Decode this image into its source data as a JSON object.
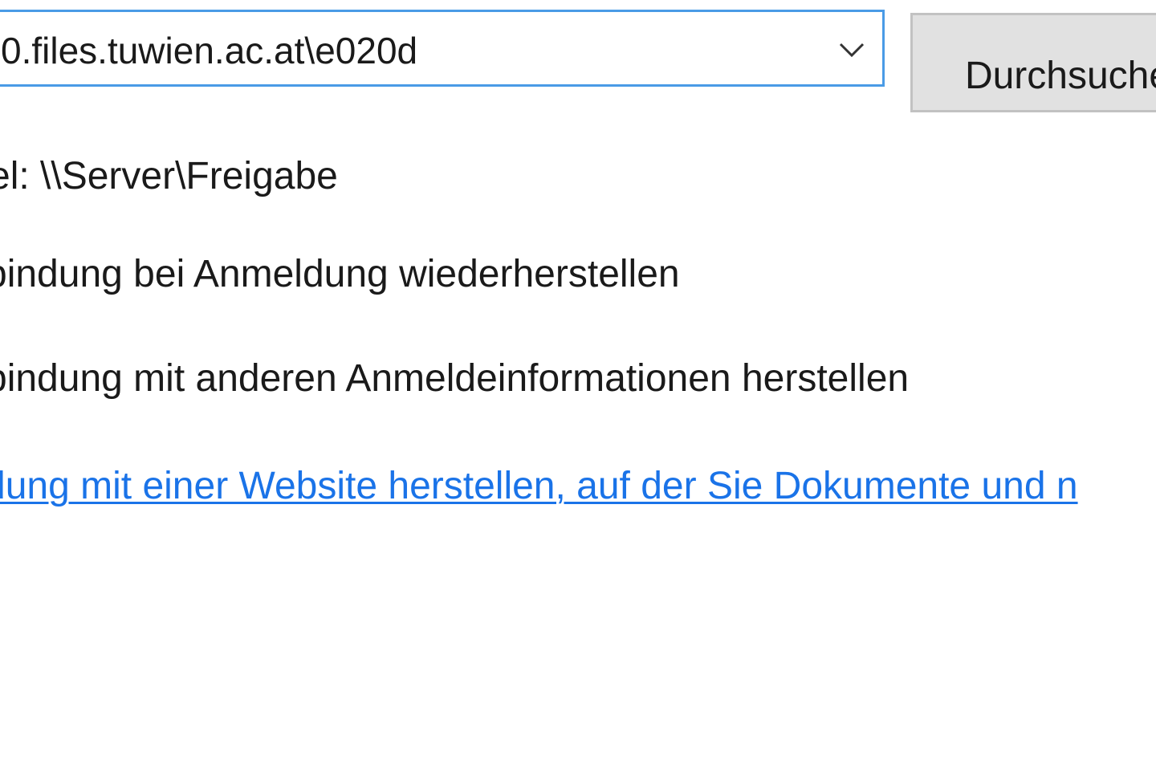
{
  "folder": {
    "value": "0.files.tuwien.ac.at\\e020d",
    "dropdown_icon": "chevron-down-icon"
  },
  "browse_button": {
    "label": "Durchsuche"
  },
  "example": {
    "text": "el: \\\\Server\\Freigabe"
  },
  "options": {
    "reconnect_label": "bindung bei Anmeldung wiederherstellen",
    "other_credentials_label": "bindung mit anderen Anmeldeinformationen herstellen"
  },
  "link": {
    "text": "dung mit einer Website herstellen, auf der Sie Dokumente und n",
    "color": "#1a73e8"
  },
  "colors": {
    "accent_border": "#4a9be6",
    "button_bg": "#e1e1e1"
  }
}
